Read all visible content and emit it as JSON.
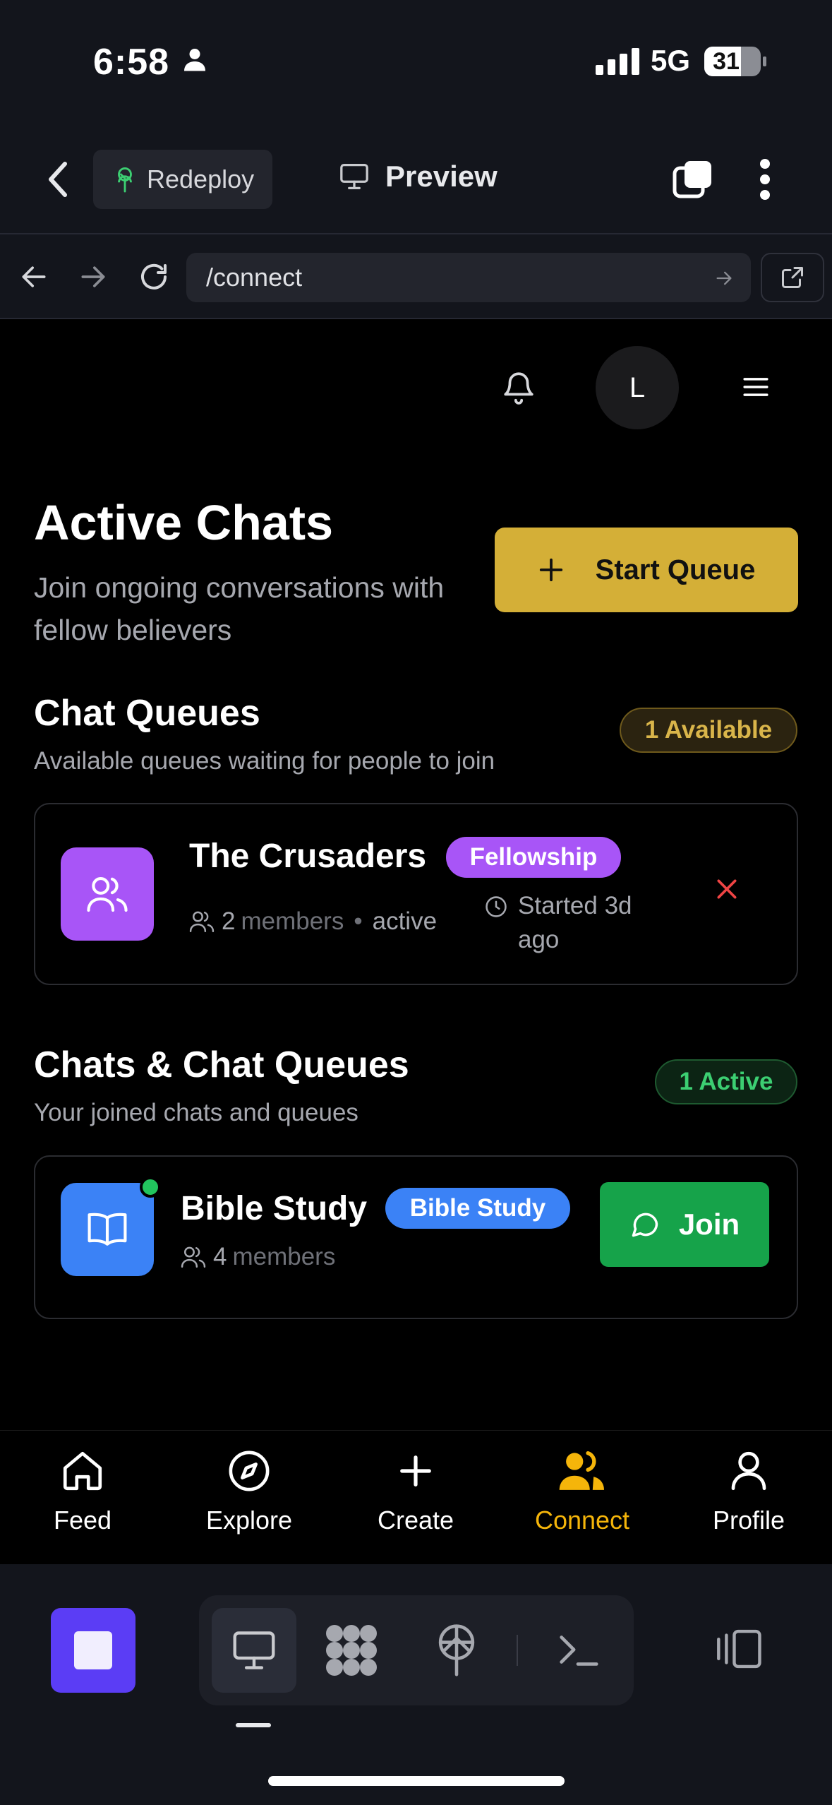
{
  "status_bar": {
    "time": "6:58",
    "network": "5G",
    "battery": "31"
  },
  "app_bar": {
    "redeploy_label": "Redeploy",
    "preview_label": "Preview"
  },
  "url_bar": {
    "path": "/connect"
  },
  "header": {
    "avatar_initial": "L"
  },
  "page": {
    "title": "Active Chats",
    "subtitle": "Join ongoing conversations with fellow believers",
    "start_queue_label": "Start Queue"
  },
  "queues": {
    "title": "Chat Queues",
    "subtitle": "Available queues waiting for people to join",
    "badge": "1 Available",
    "items": [
      {
        "name": "The Crusaders",
        "tag": "Fellowship",
        "member_count": "2",
        "members_word": "members",
        "state": "active",
        "started": "Started 3d ago"
      }
    ]
  },
  "chats": {
    "title": "Chats & Chat Queues",
    "subtitle": "Your joined chats and queues",
    "badge": "1 Active",
    "items": [
      {
        "name": "Bible Study",
        "tag": "Bible Study",
        "member_count": "4",
        "members_word": "members",
        "join_label": "Join"
      }
    ]
  },
  "bottom_nav": {
    "items": [
      {
        "label": "Feed",
        "icon": "home-icon"
      },
      {
        "label": "Explore",
        "icon": "compass-icon"
      },
      {
        "label": "Create",
        "icon": "plus-icon"
      },
      {
        "label": "Connect",
        "icon": "users-icon",
        "active": true
      },
      {
        "label": "Profile",
        "icon": "user-icon"
      }
    ]
  },
  "colors": {
    "accent_gold": "#d4af37",
    "active_nav": "#f5b50a",
    "fellowship_tag": "#a855f7",
    "bible_study_tag": "#3b82f6",
    "join_green": "#16a34a",
    "close_red": "#ef4444"
  }
}
